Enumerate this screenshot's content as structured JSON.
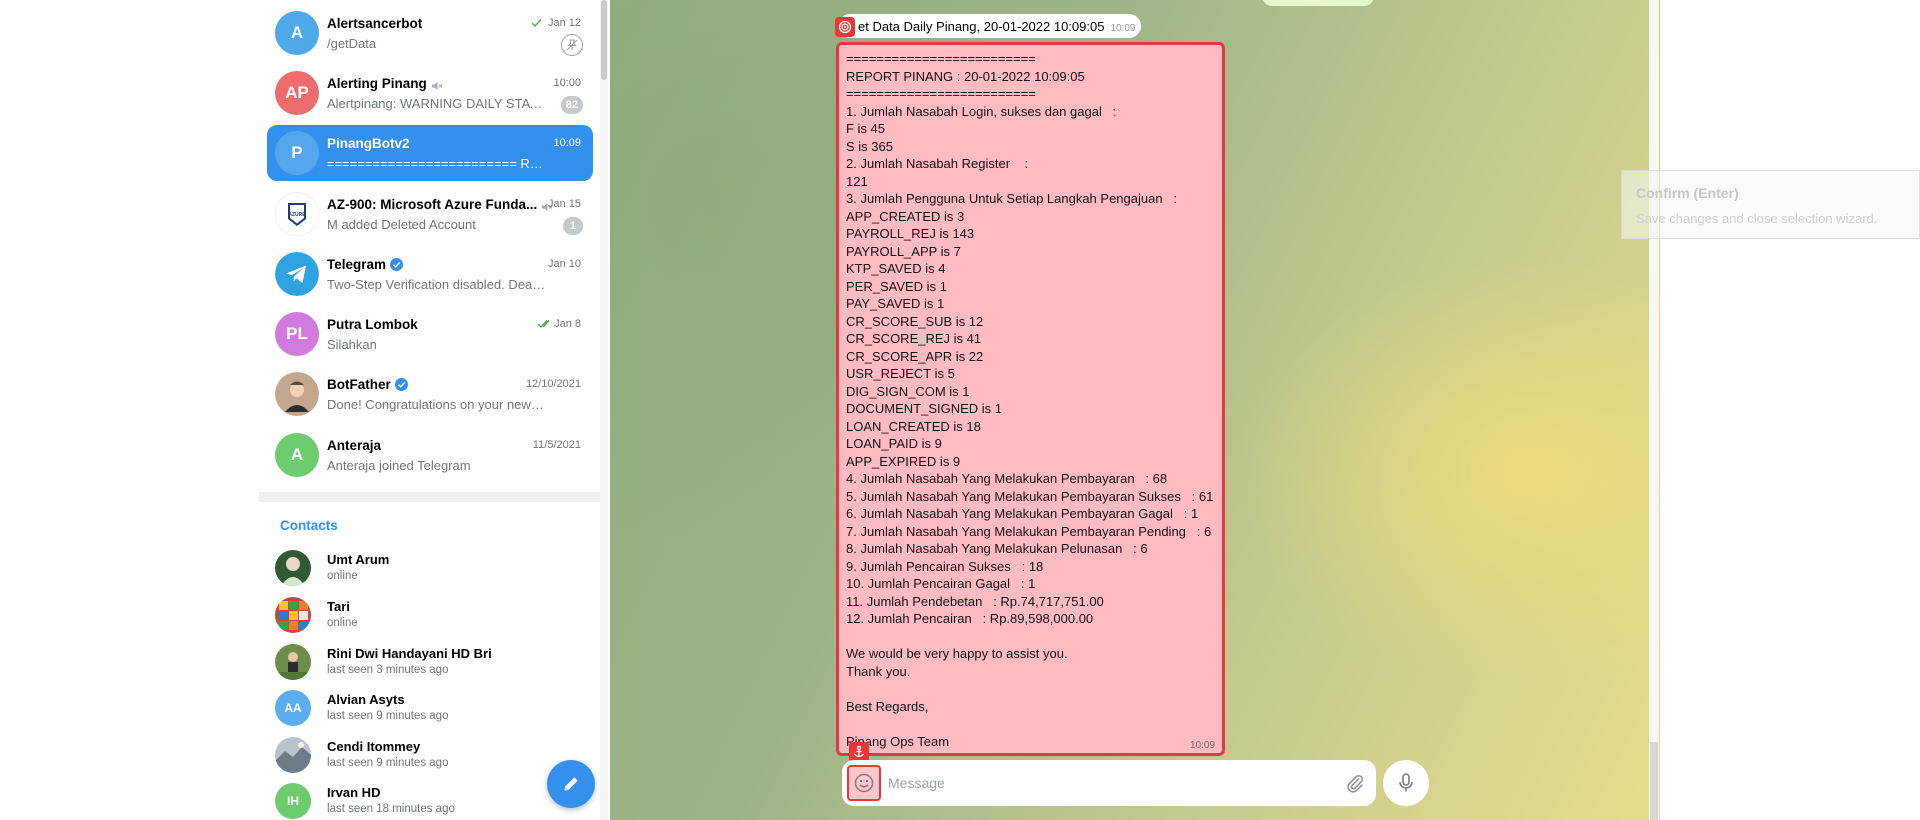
{
  "chats": [
    {
      "title": "Alertsancerbot",
      "preview": "/getData",
      "time": "Jan 12",
      "badge": "",
      "initials": "A",
      "color": "#4fa9e8",
      "muted": false,
      "verified": false,
      "read": "single",
      "pinned": true,
      "active": false
    },
    {
      "title": "Alerting Pinang",
      "preview": "Alertpinang: WARNING DAILY STATUS",
      "time": "10:00",
      "badge": "82",
      "initials": "AP",
      "color": "#ee6c6c",
      "muted": true,
      "verified": false,
      "read": "",
      "pinned": false,
      "active": false
    },
    {
      "title": "PinangBotv2",
      "preview": "========================= REPORT PINANG",
      "time": "10:09",
      "badge": "",
      "initials": "P",
      "color": "#54a7ec",
      "muted": false,
      "verified": false,
      "read": "",
      "pinned": false,
      "active": true
    },
    {
      "title": "AZ-900: Microsoft Azure Funda...",
      "preview": "M added Deleted Account",
      "time": "Jan 15",
      "badge": "1",
      "initials": "",
      "color": "#ffffff",
      "muted": true,
      "verified": false,
      "read": "",
      "pinned": false,
      "active": false
    },
    {
      "title": "Telegram",
      "preview": "Two-Step Verification disabled. Dear Ancer",
      "time": "Jan 10",
      "badge": "",
      "initials": "",
      "color": "#2fa3e0",
      "muted": false,
      "verified": true,
      "read": "",
      "pinned": false,
      "active": false
    },
    {
      "title": "Putra Lombok",
      "preview": "Silahkan",
      "time": "Jan 8",
      "badge": "",
      "initials": "PL",
      "color": "#d17bdc",
      "muted": false,
      "verified": false,
      "read": "double",
      "pinned": false,
      "active": false
    },
    {
      "title": "BotFather",
      "preview": "Done! Congratulations on your new bot. You",
      "time": "12/10/2021",
      "badge": "",
      "initials": "",
      "color": "#c2a68d",
      "muted": false,
      "verified": true,
      "read": "",
      "pinned": false,
      "active": false
    },
    {
      "title": "Anteraja",
      "preview": "Anteraja joined Telegram",
      "time": "11/5/2021",
      "badge": "",
      "initials": "A",
      "color": "#6dcc6e",
      "muted": false,
      "verified": false,
      "read": "",
      "pinned": false,
      "active": false
    }
  ],
  "contacts_title": "Contacts",
  "contacts": [
    {
      "name": "Umt Arum",
      "status": "online",
      "initials": "",
      "color": "#3c6b3f"
    },
    {
      "name": "Tari",
      "status": "online",
      "initials": "",
      "color": "#c7483a"
    },
    {
      "name": "Rini Dwi Handayani HD Bri",
      "status": "last seen 3 minutes ago",
      "initials": "",
      "color": "#6e8c4a"
    },
    {
      "name": "Alvian Asyts",
      "status": "last seen 9 minutes ago",
      "initials": "AA",
      "color": "#5aaef0"
    },
    {
      "name": "Cendi Itommey",
      "status": "last seen 9 minutes ago",
      "initials": "",
      "color": "#8d9aa6"
    },
    {
      "name": "Irvan HD",
      "status": "last seen 18 minutes ago",
      "initials": "IH",
      "color": "#6dcc6e"
    }
  ],
  "message": {
    "header": "et Data Daily Pinang, 20-01-2022 10:09:05",
    "header_time": "10:09",
    "time": "10:09",
    "lines": [
      "=========================",
      "REPORT PINANG : 20-01-2022 10:09:05",
      "=========================",
      "1. Jumlah Nasabah Login, sukses dan gagal   :",
      "F is 45",
      "S is 365",
      "2. Jumlah Nasabah Register    :",
      "121",
      "3. Jumlah Pengguna Untuk Setiap Langkah Pengajuan   :",
      "APP_CREATED is 3",
      "PAYROLL_REJ is 143",
      "PAYROLL_APP is 7",
      "KTP_SAVED is 4",
      "PER_SAVED is 1",
      "PAY_SAVED is 1",
      "CR_SCORE_SUB is 12",
      "CR_SCORE_REJ is 41",
      "CR_SCORE_APR is 22",
      "USR_REJECT is 5",
      "DIG_SIGN_COM is 1",
      "DOCUMENT_SIGNED is 1",
      "LOAN_CREATED is 18",
      "LOAN_PAID is 9",
      "APP_EXPIRED is 9",
      "4. Jumlah Nasabah Yang Melakukan Pembayaran   : 68",
      "5. Jumlah Nasabah Yang Melakukan Pembayaran Sukses   : 61",
      "6. Jumlah Nasabah Yang Melakukan Pembayaran Gagal   : 1",
      "7. Jumlah Nasabah Yang Melakukan Pembayaran Pending   : 6",
      "8. Jumlah Nasabah Yang Melakukan Pelunasan   : 6",
      "9. Jumlah Pencairan Sukses   : 18",
      "10. Jumlah Pencairan Gagal   : 1",
      "11. Jumlah Pendebetan   : Rp.74,717,751.00",
      "12. Jumlah Pencairan   : Rp.89,598,000.00",
      "",
      "We would be very happy to assist you.",
      "Thank you.",
      "",
      "Best Regards,",
      "",
      "Pinang Ops Team"
    ]
  },
  "composer": {
    "placeholder": "Message"
  },
  "tooltip": {
    "title": "Confirm (Enter)",
    "description": "Save changes and close selection wizard."
  },
  "colors": {
    "accent": "#3390ec",
    "highlight_border": "#e23a40",
    "highlight_fill": "#ffa0aa"
  }
}
